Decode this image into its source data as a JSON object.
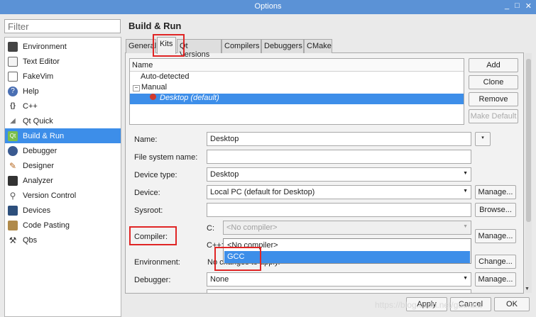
{
  "window": {
    "title": "Options",
    "controls": [
      "_",
      "□",
      "✕"
    ]
  },
  "filter": {
    "placeholder": "Filter"
  },
  "categories": [
    {
      "label": "Environment",
      "icon": "monitor-icon"
    },
    {
      "label": "Text Editor",
      "icon": "text-editor-icon"
    },
    {
      "label": "FakeVim",
      "icon": "fakevim-icon"
    },
    {
      "label": "Help",
      "icon": "help-icon"
    },
    {
      "label": "C++",
      "icon": "cpp-icon"
    },
    {
      "label": "Qt Quick",
      "icon": "qt-quick-icon"
    },
    {
      "label": "Build & Run",
      "icon": "build-run-icon",
      "selected": true
    },
    {
      "label": "Debugger",
      "icon": "debugger-icon"
    },
    {
      "label": "Designer",
      "icon": "designer-icon"
    },
    {
      "label": "Analyzer",
      "icon": "analyzer-icon"
    },
    {
      "label": "Version Control",
      "icon": "version-control-icon"
    },
    {
      "label": "Devices",
      "icon": "devices-icon"
    },
    {
      "label": "Code Pasting",
      "icon": "code-pasting-icon"
    },
    {
      "label": "Qbs",
      "icon": "qbs-icon"
    }
  ],
  "page_title": "Build & Run",
  "tabs": [
    "General",
    "Kits",
    "Qt Versions",
    "Compilers",
    "Debuggers",
    "CMake"
  ],
  "selected_tab": "Kits",
  "kit_tree": {
    "header": "Name",
    "auto_detected": "Auto-detected",
    "manual": "Manual",
    "kit": "Desktop (default)"
  },
  "kit_buttons": {
    "add": "Add",
    "clone": "Clone",
    "remove": "Remove",
    "make_default": "Make Default"
  },
  "form": {
    "name_label": "Name:",
    "name_value": "Desktop",
    "fs_label": "File system name:",
    "fs_value": "",
    "device_type_label": "Device type:",
    "device_type_value": "Desktop",
    "device_label": "Device:",
    "device_value": "Local PC (default for Desktop)",
    "device_manage": "Manage...",
    "sysroot_label": "Sysroot:",
    "sysroot_value": "",
    "sysroot_browse": "Browse...",
    "compiler_label": "Compiler:",
    "compiler_c_label": "C:",
    "compiler_c_value": "<No compiler>",
    "compiler_cpp_label": "C++:",
    "compiler_manage": "Manage...",
    "environment_label": "Environment:",
    "environment_value": "No changes to apply.",
    "environment_change": "Change...",
    "debugger_label": "Debugger:",
    "debugger_value": "None",
    "debugger_manage": "Manage..."
  },
  "compiler_dropdown": {
    "options": [
      "<No compiler>",
      "GCC"
    ],
    "highlighted": "GCC"
  },
  "dialog_buttons": {
    "apply": "Apply",
    "cancel": "Cancel",
    "ok": "OK"
  },
  "watermark": "https://blog.csdn.net/guofafa",
  "colors": {
    "titlebar": "#5b92d6",
    "selection": "#3d8ee9",
    "highlight_box": "#e02525"
  }
}
